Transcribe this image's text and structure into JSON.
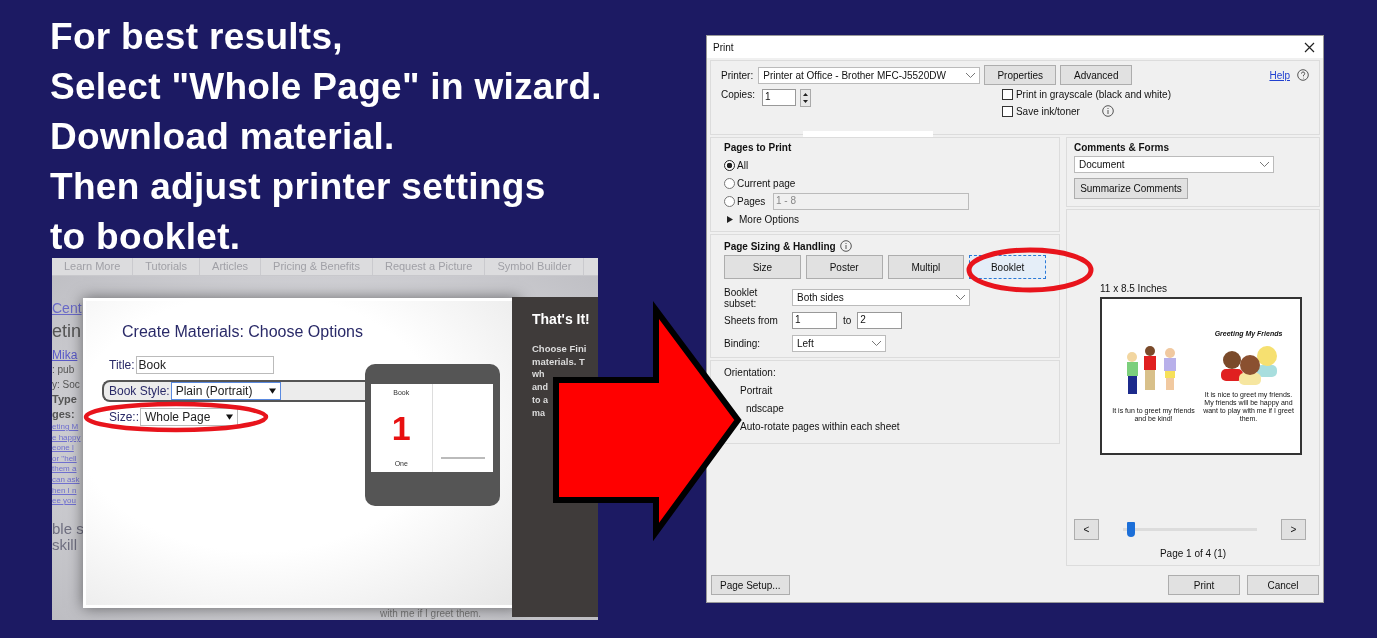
{
  "headline": [
    "For best results,",
    "Select \"Whole Page\" in wizard.",
    "Download material.",
    "Then adjust printer settings",
    "to booklet."
  ],
  "wizard_screenshot": {
    "nav": [
      "Learn More",
      "Tutorials",
      "Articles",
      "Pricing & Benefits",
      "Request a Picture",
      "Symbol Builder"
    ],
    "background_text": [
      {
        "kind": "link-large",
        "text": "Cent"
      },
      {
        "kind": "heading",
        "text": "etin"
      },
      {
        "kind": "link",
        "text": "Mika"
      },
      {
        "kind": "text",
        "text": ": pub"
      },
      {
        "kind": "text",
        "text": "y: Soc"
      },
      {
        "kind": "bold",
        "text": "Type"
      },
      {
        "kind": "bold",
        "text": "ges:"
      },
      {
        "kind": "small-link",
        "text": "eting M"
      },
      {
        "kind": "small-link",
        "text": "e happy"
      },
      {
        "kind": "small-link",
        "text": "eone l"
      },
      {
        "kind": "small-link",
        "text": "or \"hell"
      },
      {
        "kind": "small-link",
        "text": "them a"
      },
      {
        "kind": "small-link",
        "text": "can ask"
      },
      {
        "kind": "small-link",
        "text": "hen I n"
      },
      {
        "kind": "small-link",
        "text": "ee you"
      },
      {
        "kind": "body",
        "text": "ble s"
      },
      {
        "kind": "body",
        "text": "skill"
      }
    ],
    "dialog": {
      "title": "Create Materials: Choose Options",
      "fields": [
        {
          "label": "Title:",
          "kind": "text",
          "value": "Book"
        },
        {
          "label": "Book Style:",
          "kind": "select",
          "value": "Plain (Portrait)"
        },
        {
          "label": "Size::",
          "kind": "select",
          "value": "Whole Page"
        }
      ],
      "preview": {
        "heading": "Book",
        "number": "1",
        "caption": "One"
      }
    },
    "side_panel": {
      "title": "That's It!",
      "lines": [
        "Choose Fini",
        "materials. T",
        "wh",
        "and",
        "to a",
        "ma"
      ]
    },
    "bottom_text": "with me if I greet them."
  },
  "print_dialog": {
    "title": "Print",
    "printer_label": "Printer:",
    "printer": "Printer at Office - Brother MFC-J5520DW",
    "buttons_top": [
      "Properties",
      "Advanced"
    ],
    "help": "Help",
    "copies_label": "Copies:",
    "copies": "1",
    "options": [
      {
        "label": "Print in grayscale (black and white)",
        "checked": false
      },
      {
        "label": "Save ink/toner",
        "checked": false
      }
    ],
    "pages_to_print": {
      "heading": "Pages to Print",
      "choices": [
        {
          "label": "All",
          "selected": true
        },
        {
          "label": "Current page",
          "selected": false
        },
        {
          "label": "Pages",
          "selected": false
        }
      ],
      "pages_value": "1 - 8",
      "more_options": "More Options"
    },
    "comments_forms": {
      "heading": "Comments & Forms",
      "value": "Document",
      "button": "Summarize Comments"
    },
    "page_sizing": {
      "heading": "Page Sizing & Handling",
      "modes": [
        {
          "label": "Size",
          "selected": false
        },
        {
          "label": "Poster",
          "selected": false
        },
        {
          "label": "Multipl",
          "selected": false
        },
        {
          "label": "Booklet",
          "selected": true
        }
      ],
      "booklet_subset_label": "Booklet subset:",
      "booklet_subset": "Both sides",
      "sheets_label": "Sheets from",
      "sheets_from": "1",
      "to_label": "to",
      "sheets_to": "2",
      "binding_label": "Binding:",
      "binding": "Left"
    },
    "orientation": {
      "heading": "Orientation:",
      "choices": [
        "Portrait",
        "ndscape",
        "Auto-rotate pages within each sheet"
      ]
    },
    "preview": {
      "size": "11 x 8.5 Inches",
      "page_title": "Greeting My Friends",
      "left_caption": "It is fun to greet my friends and be kind!",
      "right_caption": "It is nice to greet my friends. My friends will be happy and want to play with me if I greet them.",
      "prev": "<",
      "next": ">",
      "slider": {
        "level": 0.03
      },
      "page_label": "Page 1 of 4 (1)"
    },
    "footer": {
      "page_setup": "Page Setup...",
      "print": "Print",
      "cancel": "Cancel"
    }
  }
}
